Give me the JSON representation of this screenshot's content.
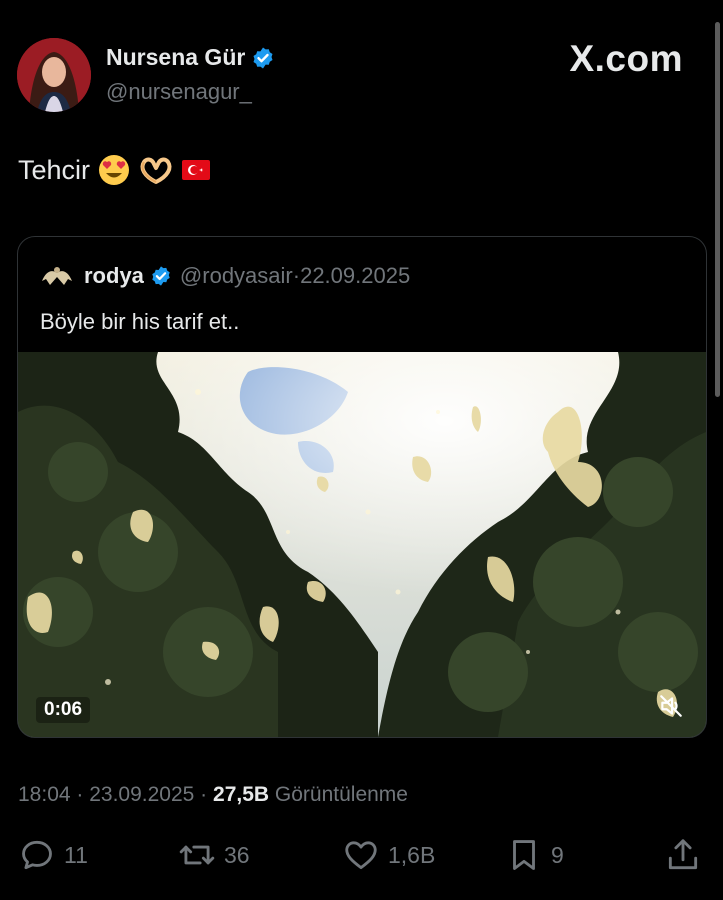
{
  "header": {
    "display_name": "Nursena Gür",
    "handle": "@nursenagur_",
    "verified_icon": "verified-badge-icon",
    "brand": "X.com"
  },
  "tweet": {
    "text": "Tehcir",
    "emojis": [
      "heart-eyes-emoji",
      "heart-hands-emoji",
      "turkey-flag-emoji"
    ]
  },
  "quote": {
    "name": "rodya",
    "handle": "@rodyasair",
    "separator": " · ",
    "date": "22.09.2025",
    "text": "Böyle bir his tarif et..",
    "video": {
      "duration": "0:06",
      "muted": true,
      "description_icon": "butterflies-forest-video"
    }
  },
  "meta": {
    "time": "18:04",
    "sep1": " · ",
    "date": "23.09.2025",
    "sep2": " · ",
    "views_count": "27,5B",
    "views_label": " Görüntülenme"
  },
  "actions": {
    "replies": "11",
    "reposts": "36",
    "likes": "1,6B",
    "bookmarks": "9"
  },
  "colors": {
    "background": "#000000",
    "text": "#e7e9ea",
    "muted": "#71767b",
    "verified": "#1d9bf0",
    "border": "#2f3336"
  }
}
